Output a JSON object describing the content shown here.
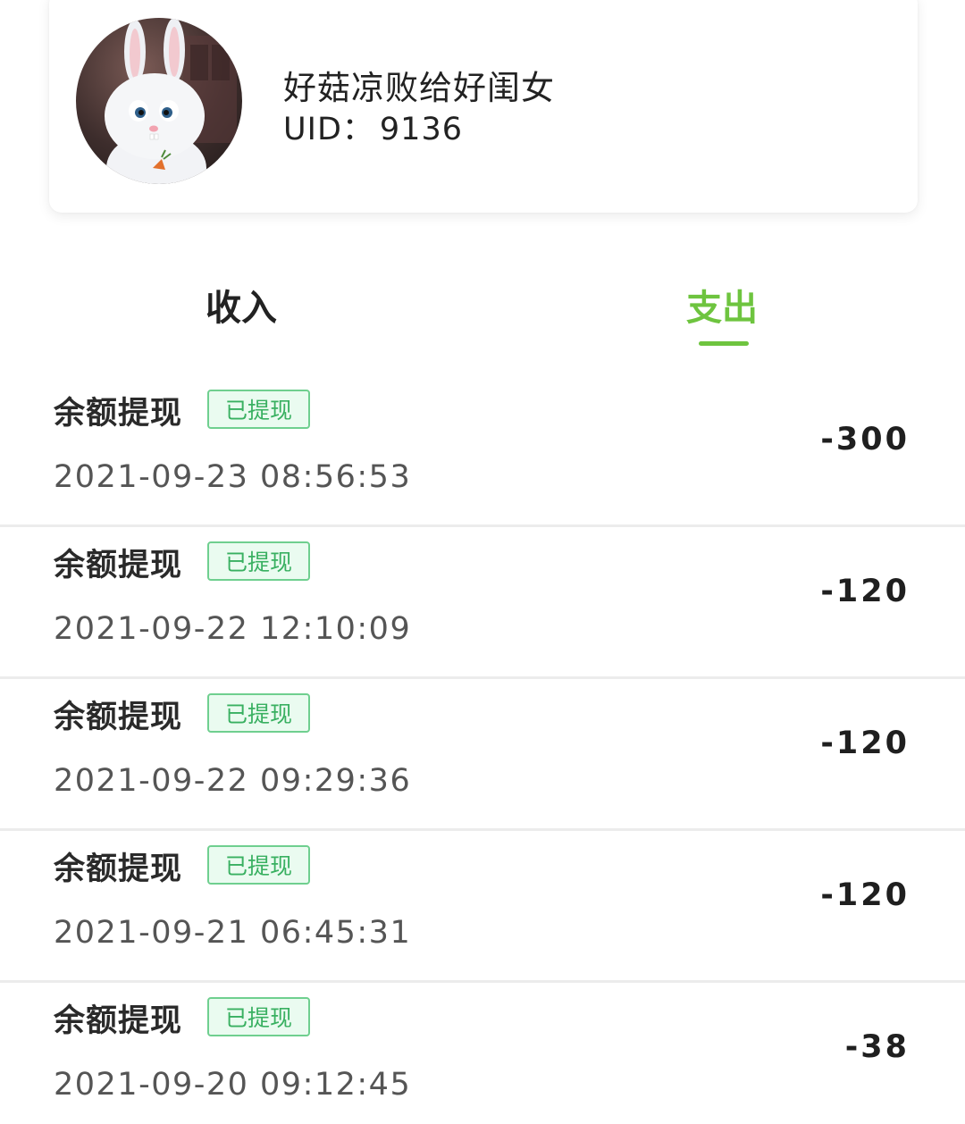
{
  "profile": {
    "avatar_icon": "rabbit-avatar",
    "name": "好菇凉败给好闺女",
    "uid_label": "UID：",
    "uid_value": "9136"
  },
  "tabs": [
    {
      "label": "收入",
      "active": false
    },
    {
      "label": "支出",
      "active": true
    }
  ],
  "colors": {
    "accent": "#6ec43f",
    "badge_text": "#39b061",
    "badge_border": "#6fcf8f"
  },
  "records": [
    {
      "title": "余额提现",
      "status": "已提现",
      "time": "2021-09-23 08:56:53",
      "amount": "-300"
    },
    {
      "title": "余额提现",
      "status": "已提现",
      "time": "2021-09-22 12:10:09",
      "amount": "-120"
    },
    {
      "title": "余额提现",
      "status": "已提现",
      "time": "2021-09-22 09:29:36",
      "amount": "-120"
    },
    {
      "title": "余额提现",
      "status": "已提现",
      "time": "2021-09-21 06:45:31",
      "amount": "-120"
    },
    {
      "title": "余额提现",
      "status": "已提现",
      "time": "2021-09-20 09:12:45",
      "amount": "-38"
    }
  ]
}
